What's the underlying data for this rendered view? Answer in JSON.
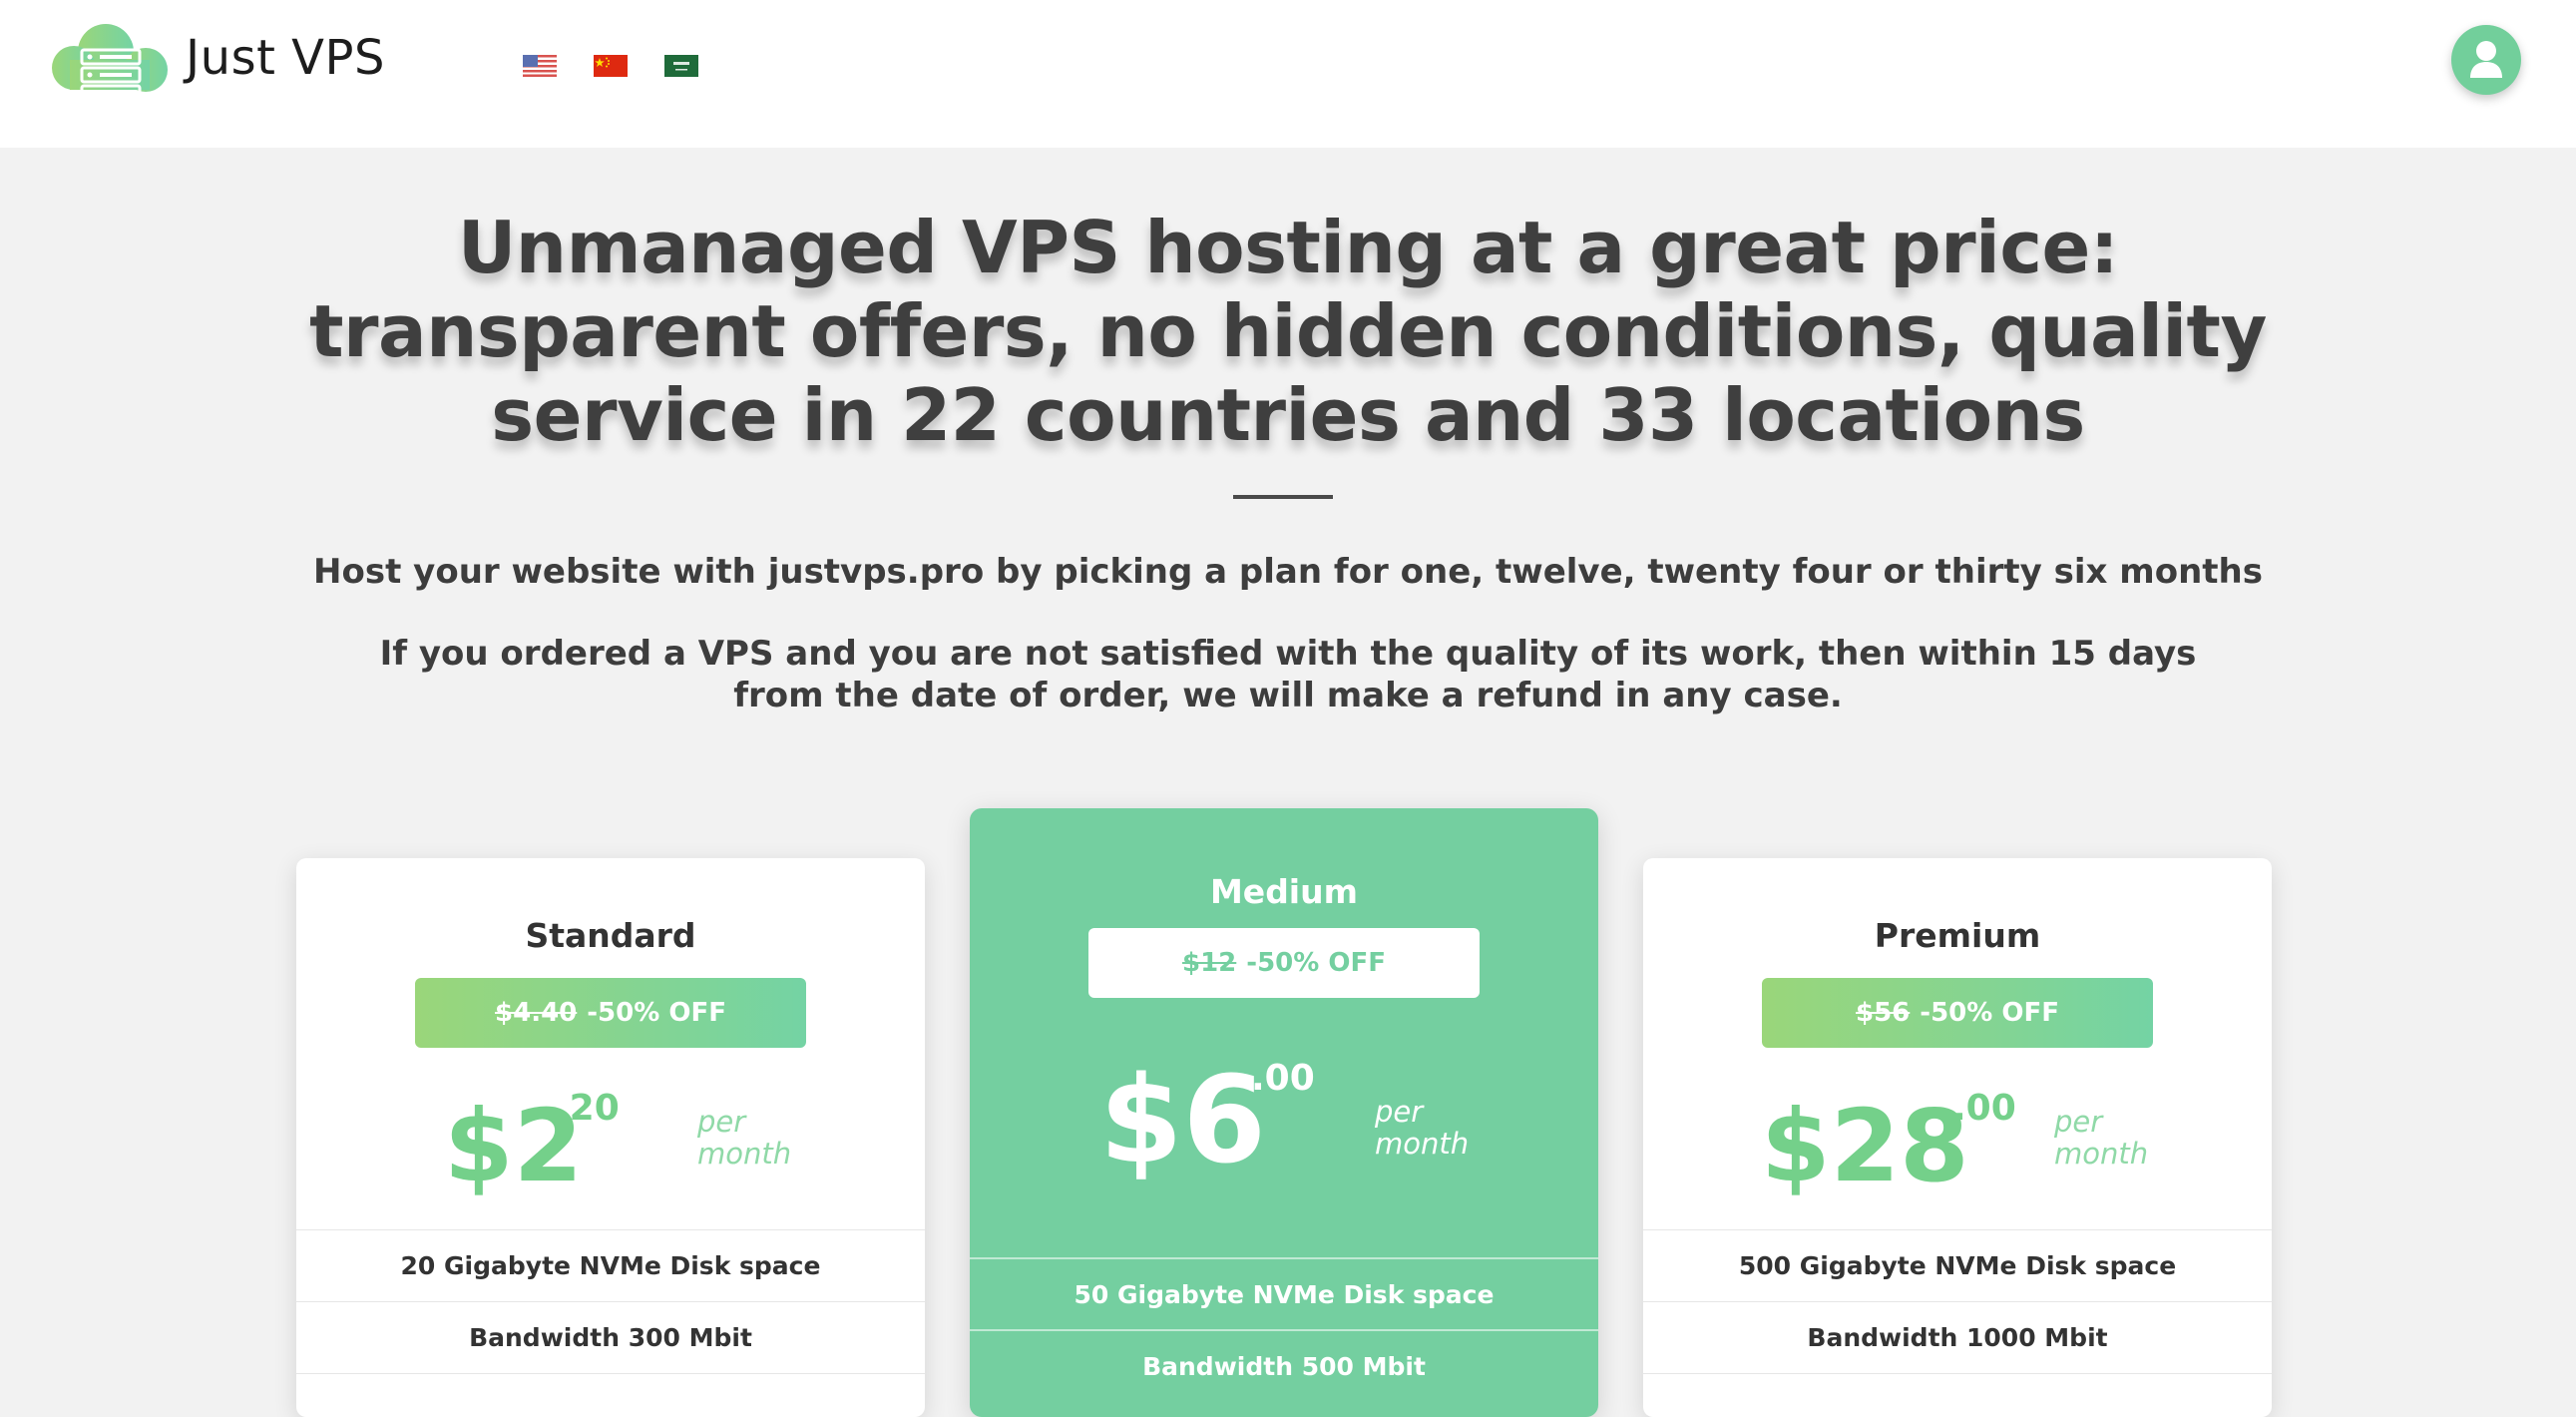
{
  "header": {
    "brand": "Just VPS",
    "logo_icon": "cloud-server-logo-icon",
    "languages": [
      {
        "name": "us-flag-icon"
      },
      {
        "name": "cn-flag-icon"
      },
      {
        "name": "sa-flag-icon"
      }
    ],
    "user_icon": "user-icon"
  },
  "hero": {
    "title": "Unmanaged VPS hosting at a great price: transparent offers, no hidden conditions, quality service in 22 countries and 33 locations",
    "subtitle": "Host your website with justvps.pro by picking a plan for one, twelve, twenty four or thirty six months",
    "refund": "If you ordered a VPS and you are not satisfied with the quality of its work, then within 15 days from the date of order, we will make a refund in any case."
  },
  "plans": [
    {
      "name": "Standard",
      "old_price": "$4.40",
      "discount": "-50% OFF",
      "price": "$2",
      "cents": ".20",
      "per": "per month",
      "features": [
        "20 Gigabyte NVMe Disk space",
        "Bandwidth 300 Mbit",
        ""
      ]
    },
    {
      "name": "Medium",
      "old_price": "$12",
      "discount": "-50% OFF",
      "price": "$6",
      "cents": ".00",
      "per": "per month",
      "features": [
        "50 Gigabyte NVMe Disk space",
        "Bandwidth 500 Mbit"
      ]
    },
    {
      "name": "Premium",
      "old_price": "$56",
      "discount": "-50% OFF",
      "price": "$28",
      "cents": ".00",
      "per": "per month",
      "features": [
        "500 Gigabyte NVMe Disk space",
        "Bandwidth 1000 Mbit",
        ""
      ]
    }
  ],
  "colors": {
    "accent": "#74cfa0",
    "price_green": "#74d08a",
    "gradient_start": "#9ad67a",
    "gradient_end": "#74d3a4",
    "text": "#3d3d3d",
    "background": "#f2f2f2"
  }
}
